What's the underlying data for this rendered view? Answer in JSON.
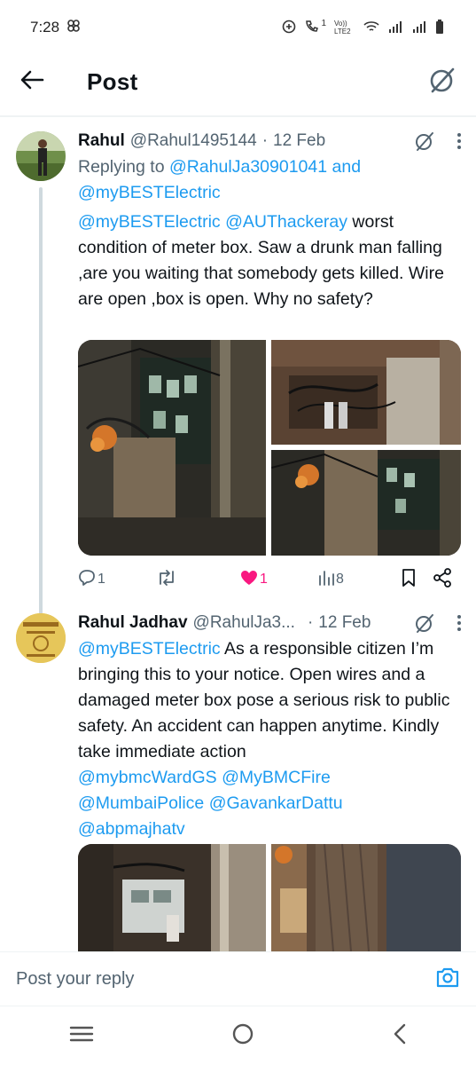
{
  "status_bar": {
    "time": "7:28",
    "network_label": "Vo)) LTE2",
    "sim1": "1"
  },
  "header": {
    "title": "Post"
  },
  "tweet1": {
    "name": "Rahul",
    "handle": "@Rahul1495144",
    "separator": "·",
    "date": "12 Feb",
    "replying_prefix": "Replying to ",
    "replying_user1": "@RahulJa30901041",
    "replying_and": " and",
    "replying_user2": "@myBESTElectric",
    "mention1": "@myBESTElectric",
    "mention2": "@AUThackeray",
    "body": "worst condition of meter box. Saw a drunk man falling ,are you waiting that somebody gets killed. Wire are open ,box is open. Why no safety?",
    "reply_count": "1",
    "repost_count": "",
    "like_count": "1",
    "view_count": "8"
  },
  "tweet2": {
    "name": "Rahul Jadhav",
    "handle": "@RahulJa3...",
    "separator": "·",
    "date": "12 Feb",
    "mention_lead": "@myBESTElectric",
    "body": " As a responsible citizen I’m bringing this to your notice. Open wires and a damaged meter box pose a serious risk to public safety. An accident can happen anytime. Kindly take immediate action",
    "tag1": "@mybmcWardGS",
    "tag2": "@MyBMCFire",
    "tag3": "@MumbaiPolice",
    "tag4": "@GavankarDattu",
    "tag5": "@abpmajhatv"
  },
  "reply_box": {
    "placeholder": "Post your reply"
  },
  "colors": {
    "link": "#1d9bf0",
    "like": "#f91880",
    "muted": "#536471",
    "text": "#0f1419"
  }
}
